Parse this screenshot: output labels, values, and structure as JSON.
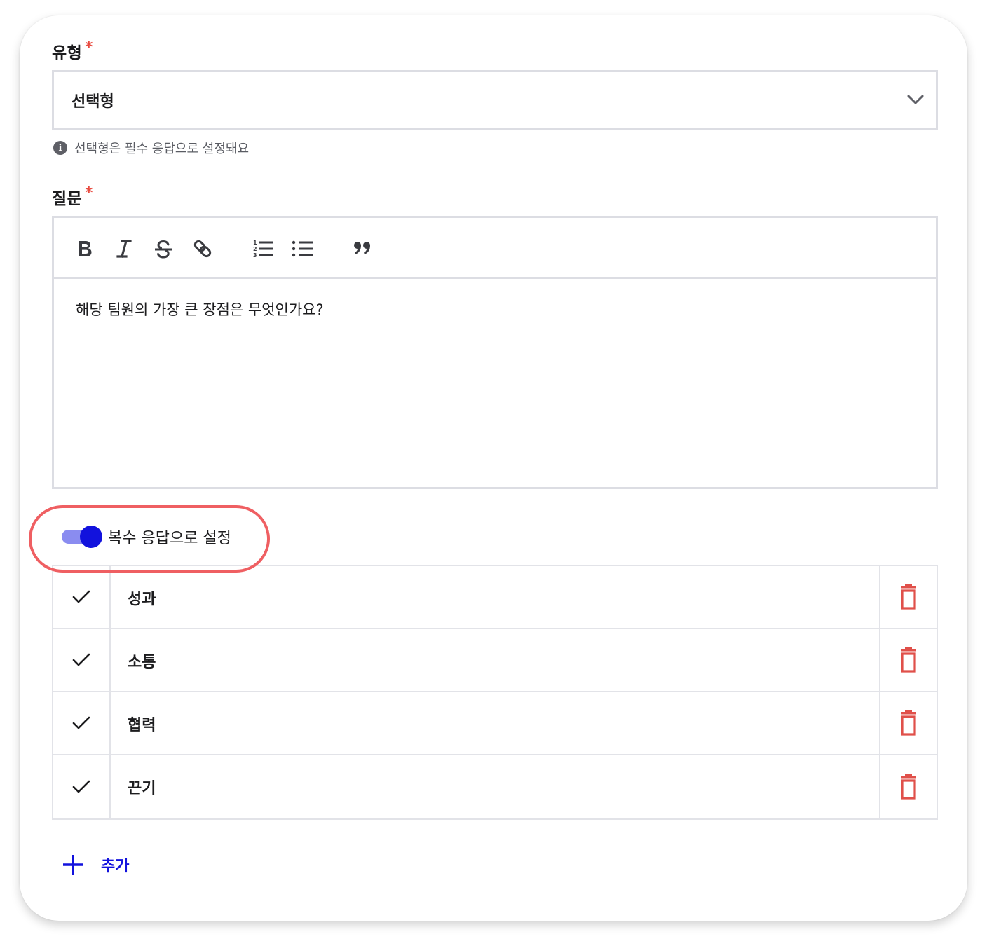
{
  "type_field": {
    "label": "유형",
    "required_mark": "*",
    "selected_value": "선택형",
    "helper_text": "선택형은 필수 응답으로 설정돼요",
    "helper_icon": "i"
  },
  "question_field": {
    "label": "질문",
    "required_mark": "*",
    "toolbar": [
      "bold-icon",
      "italic-icon",
      "strikethrough-icon",
      "link-icon",
      "ordered-list-icon",
      "bullet-list-icon",
      "quote-icon"
    ],
    "content": "해당 팀원의 가장 큰 장점은 무엇인가요?"
  },
  "multi_response": {
    "label": "복수 응답으로 설정",
    "enabled": true
  },
  "options": [
    {
      "label": "성과"
    },
    {
      "label": "소통"
    },
    {
      "label": "협력"
    },
    {
      "label": "끈기"
    }
  ],
  "add_button": {
    "label": "추가"
  },
  "colors": {
    "accent": "#1212dd",
    "required": "#e84a3f",
    "delete": "#e0504a",
    "highlight": "#ef5f62",
    "border": "#dcdde3"
  }
}
